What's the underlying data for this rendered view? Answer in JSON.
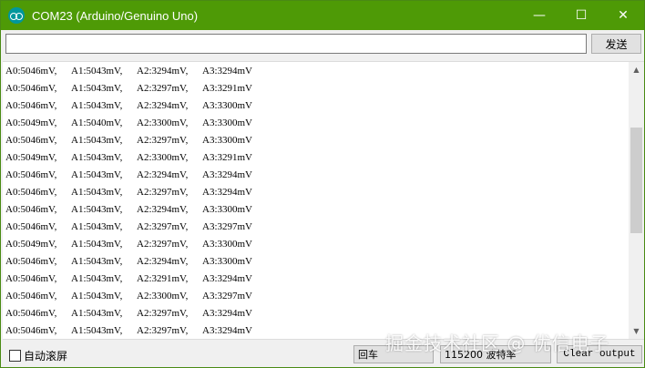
{
  "window": {
    "title": "COM23 (Arduino/Genuino Uno)",
    "controls": {
      "minimize": "—",
      "maximize": "☐",
      "close": "✕"
    },
    "accent_color": "#4e9a06"
  },
  "send_row": {
    "input_value": "",
    "send_label": "发送"
  },
  "output": {
    "lines": [
      [
        "A0:5046mV,",
        "A1:5043mV,",
        "A2:3294mV,",
        "A3:3294mV"
      ],
      [
        "A0:5046mV,",
        "A1:5043mV,",
        "A2:3297mV,",
        "A3:3291mV"
      ],
      [
        "A0:5046mV,",
        "A1:5043mV,",
        "A2:3294mV,",
        "A3:3300mV"
      ],
      [
        "A0:5049mV,",
        "A1:5040mV,",
        "A2:3300mV,",
        "A3:3300mV"
      ],
      [
        "A0:5046mV,",
        "A1:5043mV,",
        "A2:3297mV,",
        "A3:3300mV"
      ],
      [
        "A0:5049mV,",
        "A1:5043mV,",
        "A2:3300mV,",
        "A3:3291mV"
      ],
      [
        "A0:5046mV,",
        "A1:5043mV,",
        "A2:3294mV,",
        "A3:3294mV"
      ],
      [
        "A0:5046mV,",
        "A1:5043mV,",
        "A2:3297mV,",
        "A3:3294mV"
      ],
      [
        "A0:5046mV,",
        "A1:5043mV,",
        "A2:3294mV,",
        "A3:3300mV"
      ],
      [
        "A0:5046mV,",
        "A1:5043mV,",
        "A2:3297mV,",
        "A3:3297mV"
      ],
      [
        "A0:5049mV,",
        "A1:5043mV,",
        "A2:3297mV,",
        "A3:3300mV"
      ],
      [
        "A0:5046mV,",
        "A1:5043mV,",
        "A2:3294mV,",
        "A3:3300mV"
      ],
      [
        "A0:5046mV,",
        "A1:5043mV,",
        "A2:3291mV,",
        "A3:3294mV"
      ],
      [
        "A0:5046mV,",
        "A1:5043mV,",
        "A2:3300mV,",
        "A3:3297mV"
      ],
      [
        "A0:5046mV,",
        "A1:5043mV,",
        "A2:3297mV,",
        "A3:3294mV"
      ],
      [
        "A0:5046mV,",
        "A1:5043mV,",
        "A2:3297mV,",
        "A3:3294mV"
      ]
    ],
    "scroll_arrows": {
      "up": "▲",
      "down": "▼"
    }
  },
  "bottom": {
    "autoscroll_label": "自动滚屏",
    "autoscroll_checked": false,
    "line_ending": "回车",
    "baud_rate": "115200 波特率",
    "clear_label": "Clear output"
  },
  "watermark": "掘金技术社区 @ 优信电子"
}
